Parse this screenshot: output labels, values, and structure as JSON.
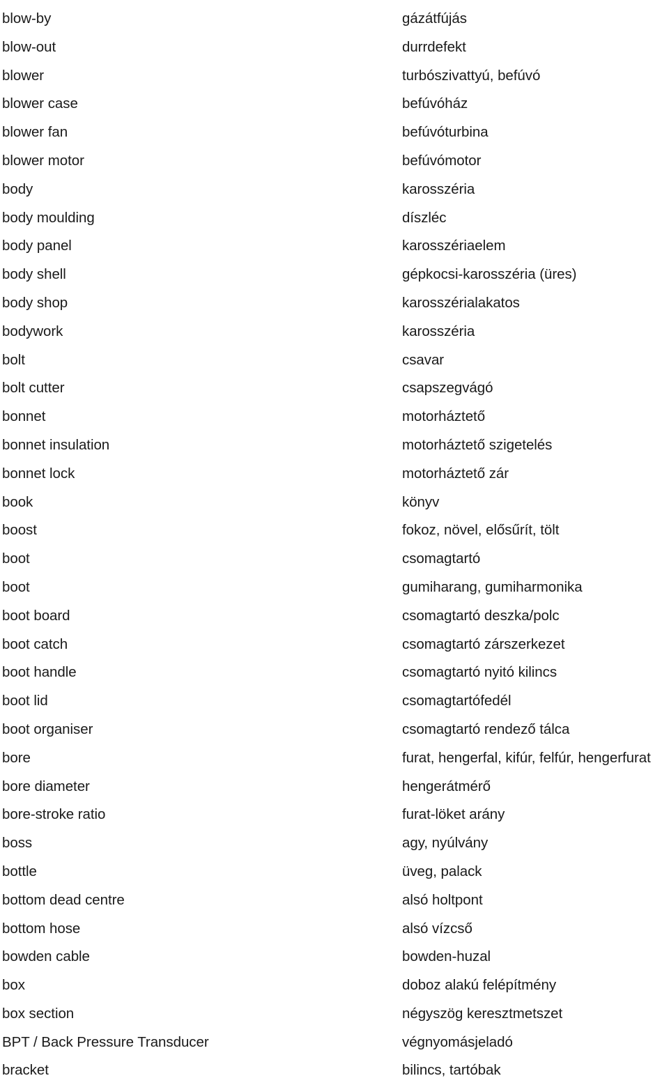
{
  "document": {
    "type": "bilingual-glossary",
    "source_language": "English",
    "target_language": "Hungarian",
    "entries": [
      {
        "term": "blow-by",
        "definition": "gázátfújás"
      },
      {
        "term": "blow-out",
        "definition": "durrdefekt"
      },
      {
        "term": "blower",
        "definition": "turbószivattyú, befúvó"
      },
      {
        "term": "blower case",
        "definition": "befúvóház"
      },
      {
        "term": "blower fan",
        "definition": "befúvóturbina"
      },
      {
        "term": "blower motor",
        "definition": "befúvómotor"
      },
      {
        "term": "body",
        "definition": "karosszéria"
      },
      {
        "term": "body moulding",
        "definition": "díszléc"
      },
      {
        "term": "body panel",
        "definition": "karosszériaelem"
      },
      {
        "term": "body shell",
        "definition": "gépkocsi-karosszéria (üres)"
      },
      {
        "term": "body shop",
        "definition": "karosszérialakatos"
      },
      {
        "term": "bodywork",
        "definition": "karosszéria"
      },
      {
        "term": "bolt",
        "definition": "csavar"
      },
      {
        "term": "bolt cutter",
        "definition": "csapszegvágó"
      },
      {
        "term": "bonnet",
        "definition": "motorháztető"
      },
      {
        "term": "bonnet insulation",
        "definition": "motorháztető szigetelés"
      },
      {
        "term": "bonnet lock",
        "definition": "motorháztető zár"
      },
      {
        "term": "book",
        "definition": "könyv"
      },
      {
        "term": "boost",
        "definition": "fokoz, növel, elősűrít, tölt"
      },
      {
        "term": "boot",
        "definition": "csomagtartó"
      },
      {
        "term": "boot",
        "definition": "gumiharang, gumiharmonika"
      },
      {
        "term": "boot board",
        "definition": "csomagtartó deszka/polc"
      },
      {
        "term": "boot catch",
        "definition": "csomagtartó zárszerkezet"
      },
      {
        "term": "boot handle",
        "definition": "csomagtartó nyitó kilincs"
      },
      {
        "term": "boot lid",
        "definition": "csomagtartófedél"
      },
      {
        "term": "boot organiser",
        "definition": "csomagtartó rendező tálca"
      },
      {
        "term": "bore",
        "definition": "furat, hengerfal, kifúr, felfúr, hengerfurat"
      },
      {
        "term": "bore diameter",
        "definition": "hengerátmérő"
      },
      {
        "term": "bore-stroke ratio",
        "definition": "furat-löket arány"
      },
      {
        "term": "boss",
        "definition": "agy, nyúlvány"
      },
      {
        "term": "bottle",
        "definition": "üveg, palack"
      },
      {
        "term": "bottom dead centre",
        "definition": "alsó holtpont"
      },
      {
        "term": "bottom hose",
        "definition": "alsó vízcső"
      },
      {
        "term": "bowden cable",
        "definition": "bowden-huzal"
      },
      {
        "term": "box",
        "definition": "doboz alakú felépítmény"
      },
      {
        "term": "box section",
        "definition": "négyszög keresztmetszet"
      },
      {
        "term": "BPT / Back Pressure Transducer",
        "definition": "végnyomásjeladó"
      },
      {
        "term": "bracket",
        "definition": "bilincs, tartóbak"
      }
    ]
  }
}
